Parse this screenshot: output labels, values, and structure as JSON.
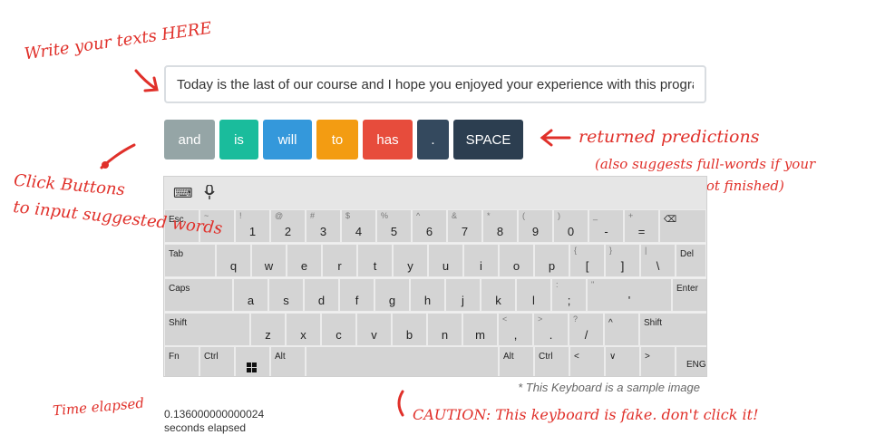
{
  "annotations": {
    "write_here": "Write your texts HERE",
    "returned": "returned predictions",
    "returned_note_line1": "(also suggests full-words if your",
    "returned_note_line2": "word input is not finished)",
    "click_line1": "Click Buttons",
    "click_line2": "to input suggested words",
    "time_elapsed": "Time elapsed",
    "caution": "CAUTION: This keyboard is fake. don't click it!"
  },
  "input": {
    "value": "Today is the last of our course and I hope you enjoyed your experience with this program"
  },
  "predictions": [
    {
      "label": "and",
      "color": "#95a5a6"
    },
    {
      "label": "is",
      "color": "#1abc9c"
    },
    {
      "label": "will",
      "color": "#3498db"
    },
    {
      "label": "to",
      "color": "#f39c12"
    },
    {
      "label": "has",
      "color": "#e74c3c"
    },
    {
      "label": ".",
      "color": "#34495e"
    },
    {
      "label": "SPACE",
      "color": "#2c3e50"
    }
  ],
  "keyboard": {
    "toolbar_icons": [
      "keyboard-settings-icon",
      "microphone-icon"
    ],
    "row1": [
      {
        "shift": "",
        "main": "",
        "label": "Esc"
      },
      {
        "shift": "~",
        "main": "`"
      },
      {
        "shift": "!",
        "main": "1"
      },
      {
        "shift": "@",
        "main": "2"
      },
      {
        "shift": "#",
        "main": "3"
      },
      {
        "shift": "$",
        "main": "4"
      },
      {
        "shift": "%",
        "main": "5"
      },
      {
        "shift": "^",
        "main": "6"
      },
      {
        "shift": "&",
        "main": "7"
      },
      {
        "shift": "*",
        "main": "8"
      },
      {
        "shift": "(",
        "main": "9"
      },
      {
        "shift": ")",
        "main": "0"
      },
      {
        "shift": "_",
        "main": "-"
      },
      {
        "shift": "+",
        "main": "="
      },
      {
        "shift": "",
        "main": "",
        "label": "⌫"
      }
    ],
    "row2": [
      {
        "label": "Tab"
      },
      {
        "main": "q"
      },
      {
        "main": "w"
      },
      {
        "main": "e"
      },
      {
        "main": "r"
      },
      {
        "main": "t"
      },
      {
        "main": "y"
      },
      {
        "main": "u"
      },
      {
        "main": "i"
      },
      {
        "main": "o"
      },
      {
        "main": "p"
      },
      {
        "shift": "{",
        "main": "["
      },
      {
        "shift": "}",
        "main": "]"
      },
      {
        "shift": "|",
        "main": "\\"
      },
      {
        "label": "Del"
      }
    ],
    "row3": [
      {
        "label": "Caps"
      },
      {
        "main": "a"
      },
      {
        "main": "s"
      },
      {
        "main": "d"
      },
      {
        "main": "f"
      },
      {
        "main": "g"
      },
      {
        "main": "h"
      },
      {
        "main": "j"
      },
      {
        "main": "k"
      },
      {
        "main": "l"
      },
      {
        "shift": ":",
        "main": ";"
      },
      {
        "shift": "\"",
        "main": "'"
      },
      {
        "label": "Enter"
      }
    ],
    "row4": [
      {
        "label": "Shift"
      },
      {
        "main": "z"
      },
      {
        "main": "x"
      },
      {
        "main": "c"
      },
      {
        "main": "v"
      },
      {
        "main": "b"
      },
      {
        "main": "n"
      },
      {
        "main": "m"
      },
      {
        "shift": "<",
        "main": ","
      },
      {
        "shift": ">",
        "main": "."
      },
      {
        "shift": "?",
        "main": "/"
      },
      {
        "label": "^"
      },
      {
        "label": "Shift"
      }
    ],
    "row5": [
      {
        "label": "Fn"
      },
      {
        "label": "Ctrl"
      },
      {
        "label": "windows-icon"
      },
      {
        "label": "Alt"
      },
      {
        "label": ""
      },
      {
        "label": "Alt"
      },
      {
        "label": "Ctrl"
      },
      {
        "label": "<"
      },
      {
        "label": "∨"
      },
      {
        "label": ">"
      },
      {
        "label": "ENG"
      }
    ]
  },
  "caption": "* This Keyboard is a sample image",
  "timer": {
    "value": "0.136000000000024",
    "unit": "seconds elapsed"
  },
  "colors": {
    "annotation": "#e0302a"
  }
}
